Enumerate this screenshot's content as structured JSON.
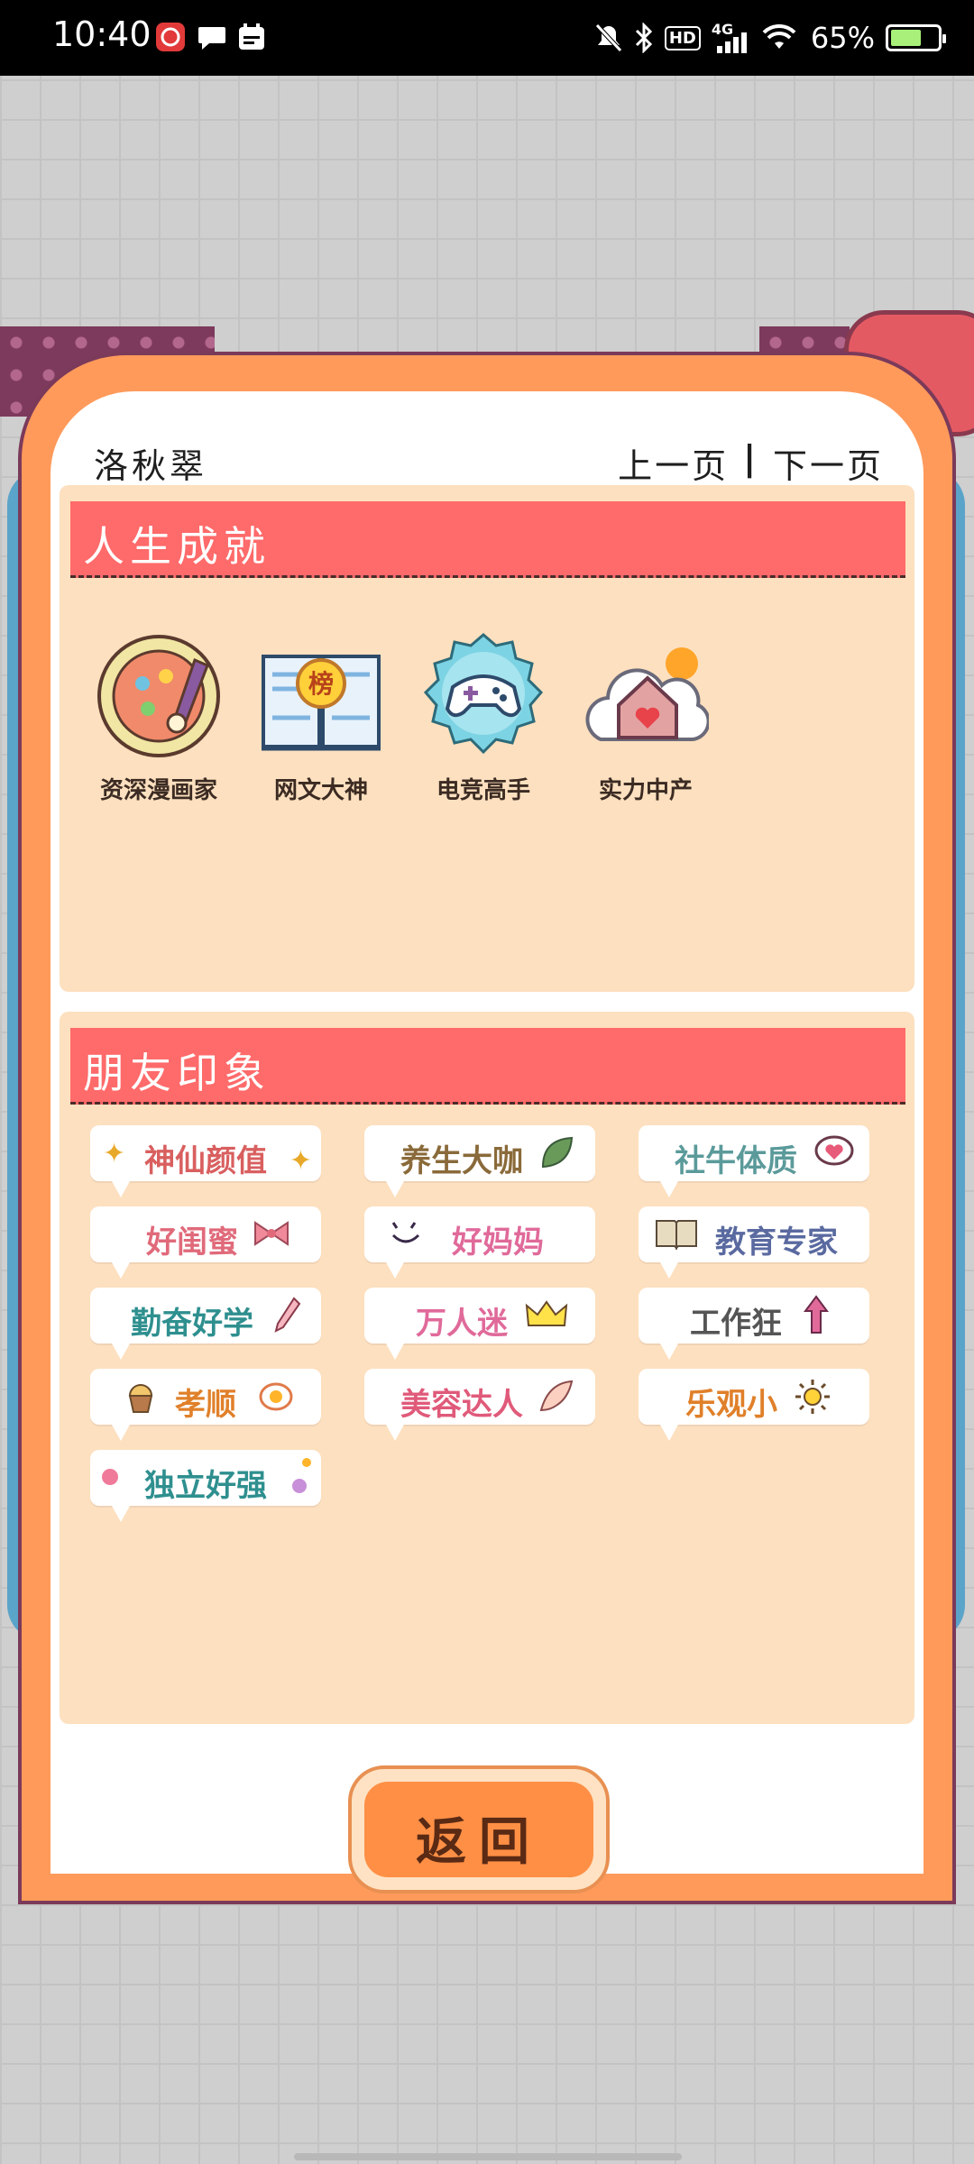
{
  "status_bar": {
    "time": "10:40",
    "network": "4G",
    "hd": "HD",
    "battery_percent": "65%",
    "battery_level": 0.65
  },
  "panel": {
    "player_name": "洛秋翠",
    "prev_page": "上一页",
    "separator": "|",
    "next_page": "下一页"
  },
  "achievements": {
    "title": "人生成就",
    "items": [
      {
        "label": "资深漫画家",
        "icon": "palette-icon"
      },
      {
        "label": "网文大神",
        "icon": "book-ranking-icon"
      },
      {
        "label": "电竞高手",
        "icon": "gamepad-icon"
      },
      {
        "label": "实力中产",
        "icon": "house-icon"
      }
    ]
  },
  "impressions": {
    "title": "朋友印象",
    "tags": [
      {
        "label": "神仙颜值",
        "color": "#d95f5f",
        "deco": "sparkle-icon"
      },
      {
        "label": "养生大咖",
        "color": "#8a6a3a",
        "deco": "leaf-icon"
      },
      {
        "label": "社牛体质",
        "color": "#5b9a9a",
        "deco": "heart-bubble-icon"
      },
      {
        "label": "好闺蜜",
        "color": "#e06a7a",
        "deco": "bow-icon"
      },
      {
        "label": "好妈妈",
        "color": "#e06a9a",
        "deco": "smile-icon"
      },
      {
        "label": "教育专家",
        "color": "#5a6aa0",
        "deco": "book-icon"
      },
      {
        "label": "勤奋好学",
        "color": "#2f8f8f",
        "deco": "pencil-icon"
      },
      {
        "label": "万人迷",
        "color": "#e06a9a",
        "deco": "crown-icon"
      },
      {
        "label": "工作狂",
        "color": "#555555",
        "deco": "arrow-up-icon"
      },
      {
        "label": "孝顺",
        "color": "#e0802a",
        "deco": "muffin-icon"
      },
      {
        "label": "美容达人",
        "color": "#e05a7a",
        "deco": "wing-icon"
      },
      {
        "label": "乐观小",
        "color": "#e0802a",
        "deco": "sun-icon"
      },
      {
        "label": "独立好强",
        "color": "#2f8f8f",
        "deco": "dots-icon"
      }
    ]
  },
  "return_button": {
    "label": "返回"
  }
}
